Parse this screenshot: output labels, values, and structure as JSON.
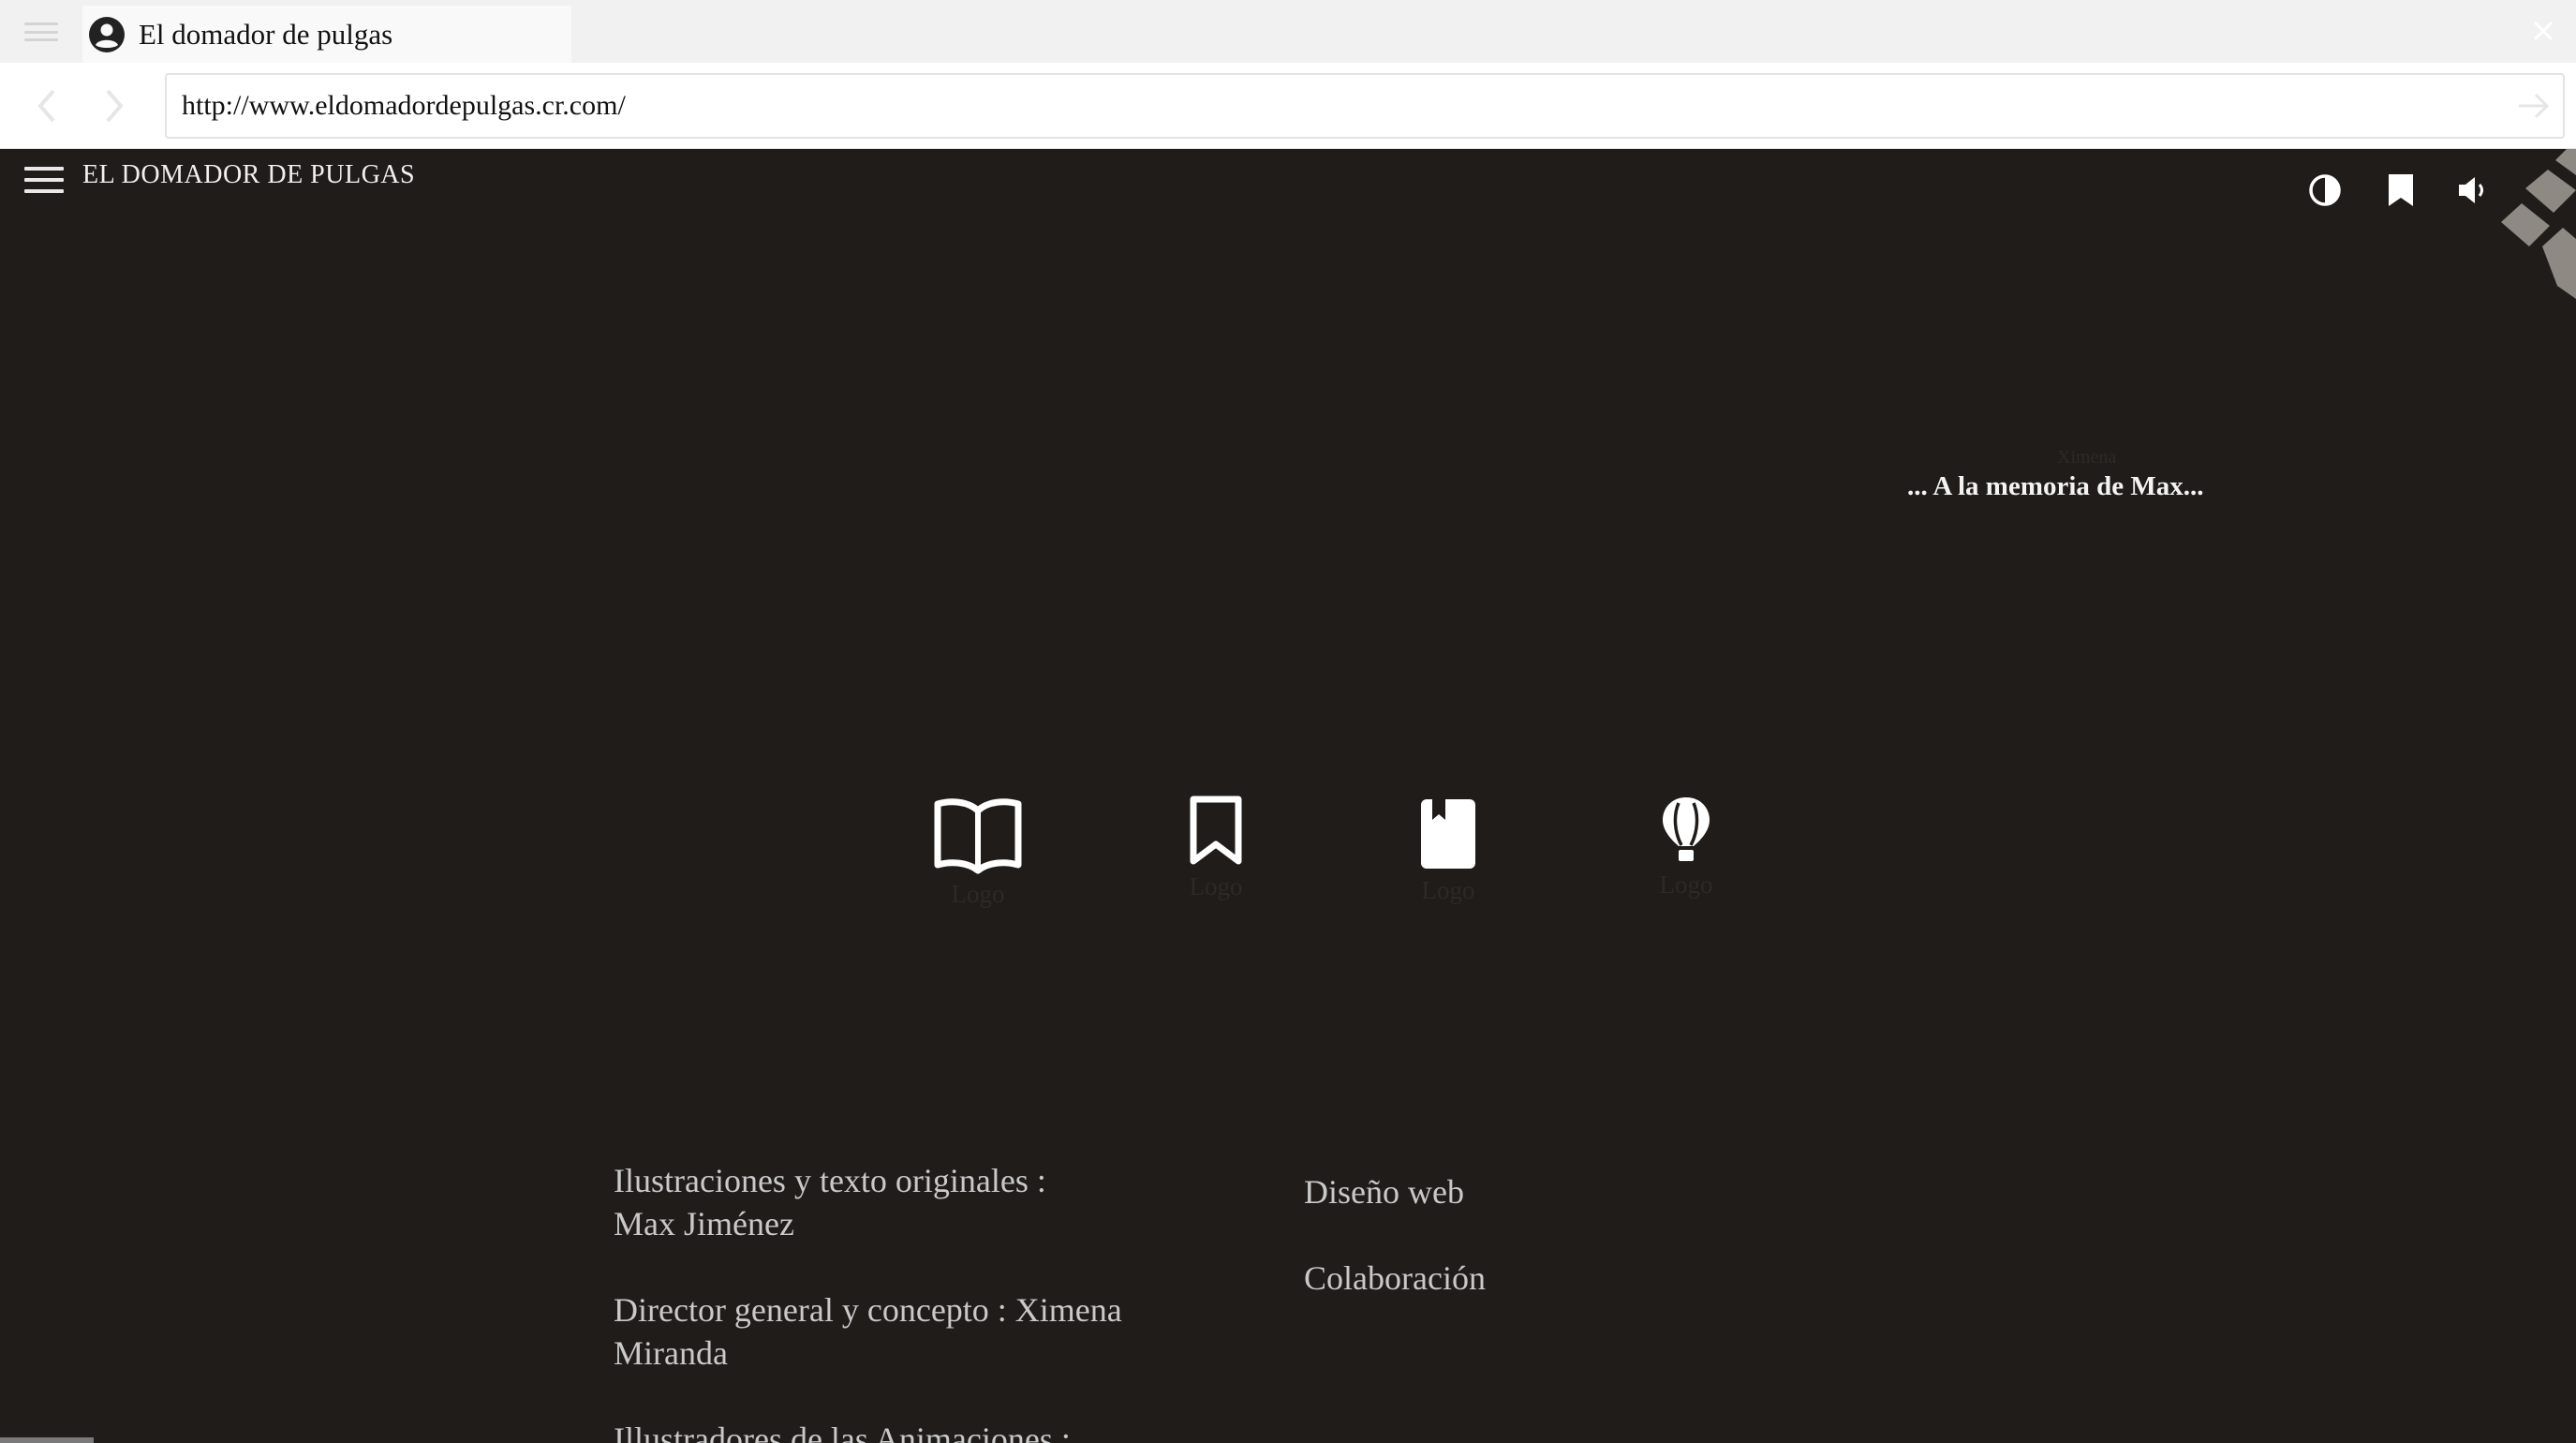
{
  "browser": {
    "tab_title": "El domador de pulgas",
    "url": "http://www.eldomadordepulgas.cr.com/"
  },
  "header": {
    "site_title": "EL DOMADOR DE PULGAS",
    "icons": [
      "contrast-icon",
      "bookmark-icon",
      "volume-icon"
    ]
  },
  "hero": {
    "dedication_faint": "Ximena",
    "dedication": "... A la memoria de Max..."
  },
  "features": [
    {
      "icon": "open-book-icon",
      "label": "Logo"
    },
    {
      "icon": "bookmark-icon",
      "label": "Logo"
    },
    {
      "icon": "book-icon",
      "label": "Logo"
    },
    {
      "icon": "hot-air-balloon-icon",
      "label": "Logo"
    }
  ],
  "credits": {
    "items": [
      {
        "line1": "Ilustraciones y texto originales :",
        "line2": "Max Jiménez"
      },
      {
        "line1": "Director general y concepto : Ximena",
        "line2": "Miranda"
      },
      {
        "line1": "Illustradores de las Animaciones :",
        "line2": ""
      }
    ],
    "links": [
      "Diseño web",
      "Colaboración"
    ]
  },
  "colors": {
    "page_background": "#1f1c1a",
    "text_light": "#c9c9c9",
    "icon_white": "#ffffff"
  }
}
